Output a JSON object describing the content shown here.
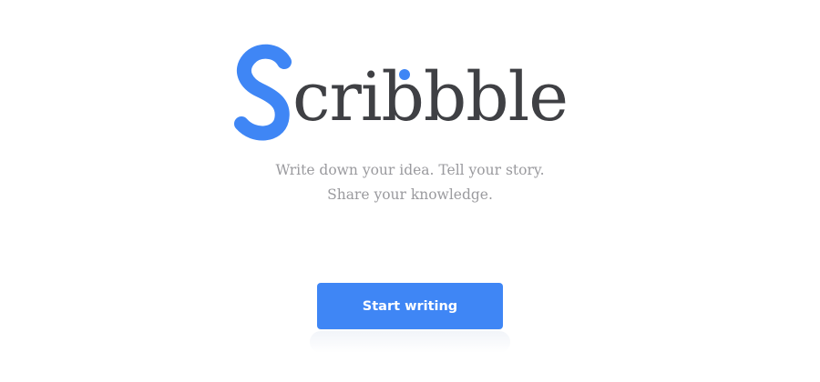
{
  "brand": {
    "name": "Scribbble",
    "initial": "S",
    "rest": "cribbble",
    "accent_color": "#3f86f5",
    "text_color": "#3f4044"
  },
  "tagline": {
    "line1": "Write down your idea. Tell your story.",
    "line2": "Share your knowledge."
  },
  "cta": {
    "label": "Start writing",
    "color": "#3f86f5"
  }
}
